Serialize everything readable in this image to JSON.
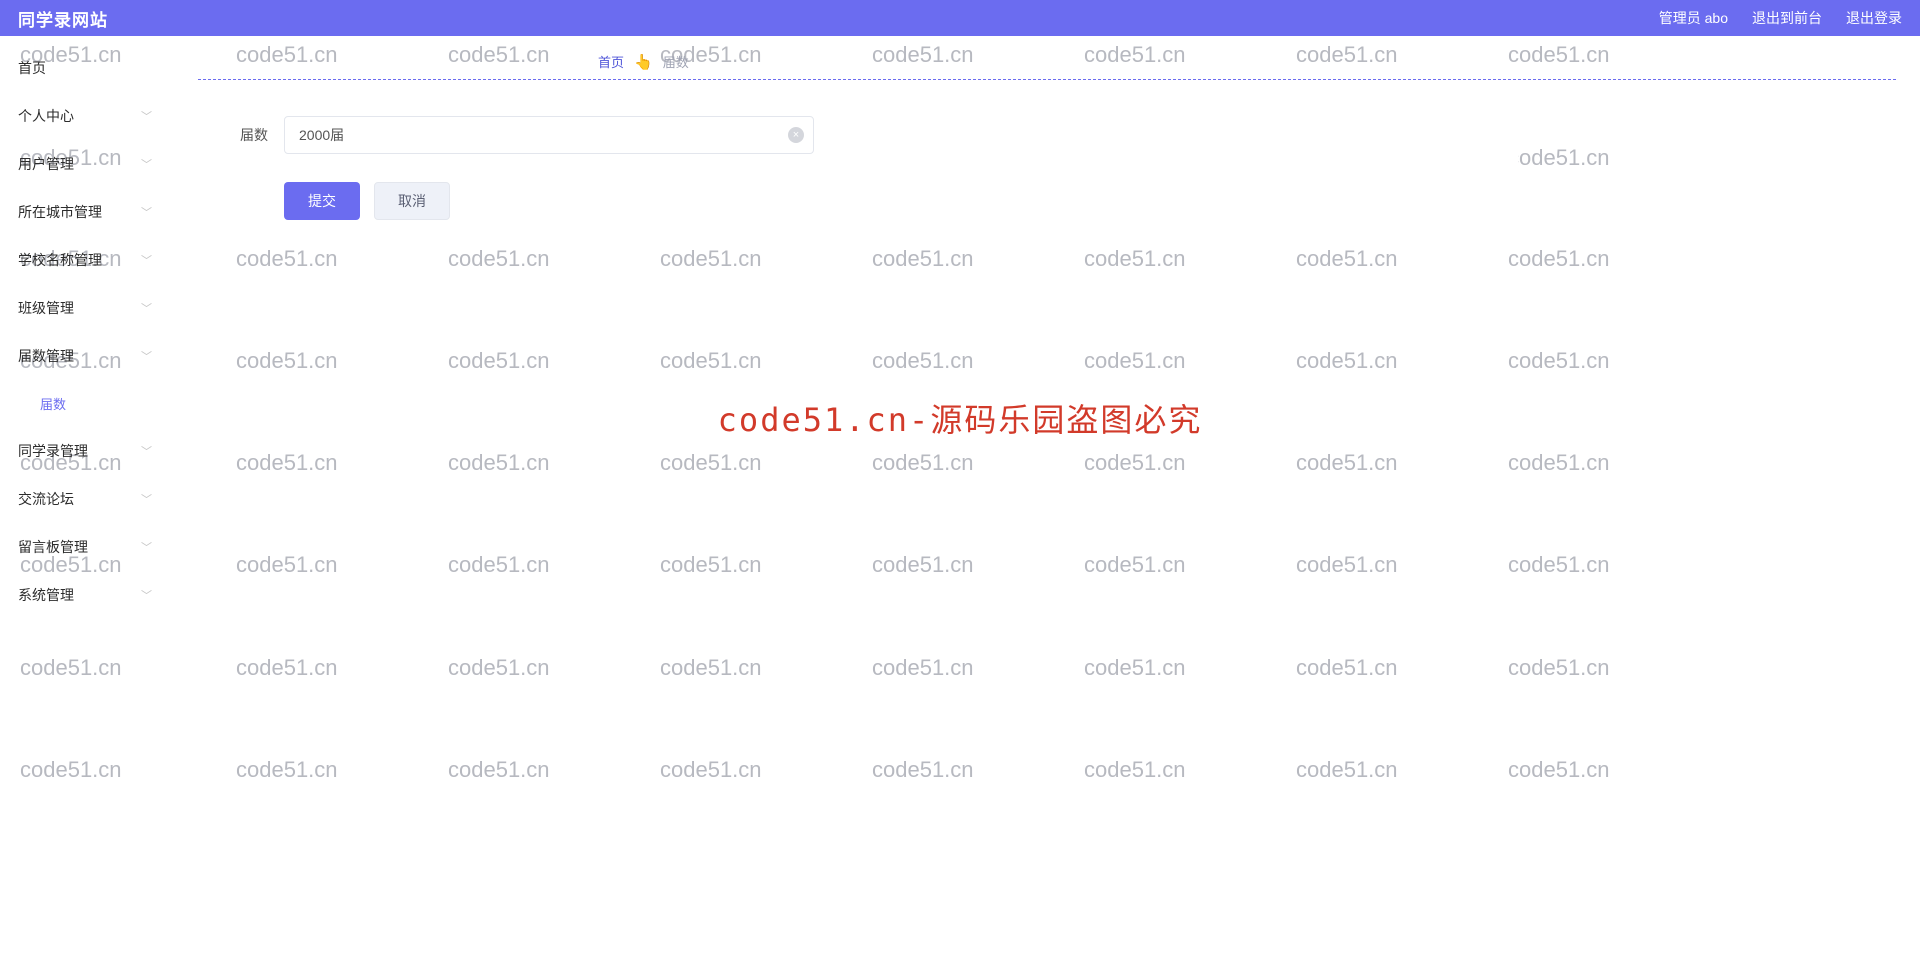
{
  "header": {
    "title": "同学录网站",
    "user_label": "管理员 abo",
    "exit_front": "退出到前台",
    "logout": "退出登录"
  },
  "sidebar": {
    "home": "首页",
    "personal": "个人中心",
    "user_mgmt": "用户管理",
    "city_mgmt": "所在城市管理",
    "school_mgmt": "学校名称管理",
    "class_mgmt": "班级管理",
    "period_mgmt": "届数管理",
    "period_sub": "届数",
    "yearbook_mgmt": "同学录管理",
    "forum": "交流论坛",
    "msgboard_mgmt": "留言板管理",
    "system_mgmt": "系统管理"
  },
  "breadcrumb": {
    "home": "首页",
    "current": "届数"
  },
  "form": {
    "label_period": "届数",
    "value_period": "2000届",
    "btn_submit": "提交",
    "btn_cancel": "取消"
  },
  "watermark": {
    "text": "code51.cn",
    "center": "code51.cn-源码乐园盗图必究"
  }
}
